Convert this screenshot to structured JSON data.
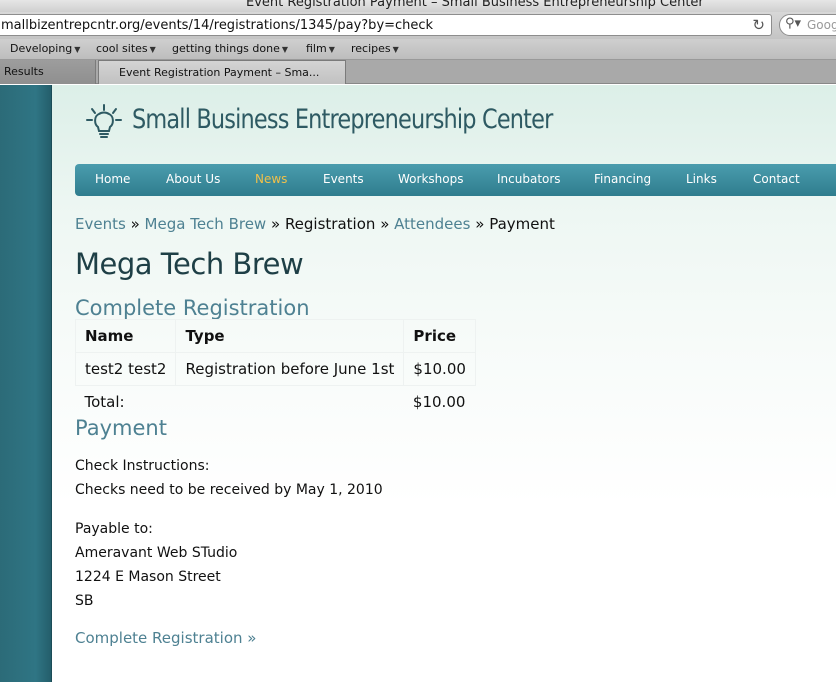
{
  "browser": {
    "window_title": "Event Registration Payment – Small Business Entrepreneurship Center",
    "url": "mallbizentrepcntr.org/events/14/registrations/1345/pay?by=check",
    "search_placeholder": "Goog",
    "bookmarks": [
      "Developing",
      "cool sites",
      "getting things done",
      "film",
      "recipes"
    ],
    "tabs": [
      "Results",
      "Event Registration Payment – Sma..."
    ]
  },
  "site": {
    "title": "Small Business Entrepreneurship Center",
    "nav": [
      "Home",
      "About Us",
      "News",
      "Events",
      "Workshops",
      "Incubators",
      "Financing",
      "Links",
      "Contact"
    ],
    "nav_current": "News",
    "colors": {
      "nav": "#3a8c9e",
      "link": "#4e8192",
      "current": "#f0c04a",
      "sidebar": "#2f7584"
    }
  },
  "breadcrumb": {
    "items": [
      "Events",
      "Mega Tech Brew",
      "Registration",
      "Attendees",
      "Payment"
    ],
    "separator": "»"
  },
  "page": {
    "title": "Mega Tech Brew",
    "section_registration": "Complete Registration",
    "table": {
      "headers": [
        "Name",
        "Type",
        "Price"
      ],
      "rows": [
        [
          "test2 test2",
          "Registration before June 1st",
          "$10.00"
        ]
      ],
      "total_label": "Total:",
      "total_value": "$10.00"
    },
    "section_payment": "Payment",
    "check_instructions_label": "Check Instructions:",
    "check_instructions_text": "Checks need to be received by May 1, 2010",
    "payable_label": "Payable to:",
    "payable_lines": [
      "Ameravant Web STudio",
      "1224 E Mason Street",
      "SB"
    ],
    "complete_link": "Complete Registration »"
  }
}
